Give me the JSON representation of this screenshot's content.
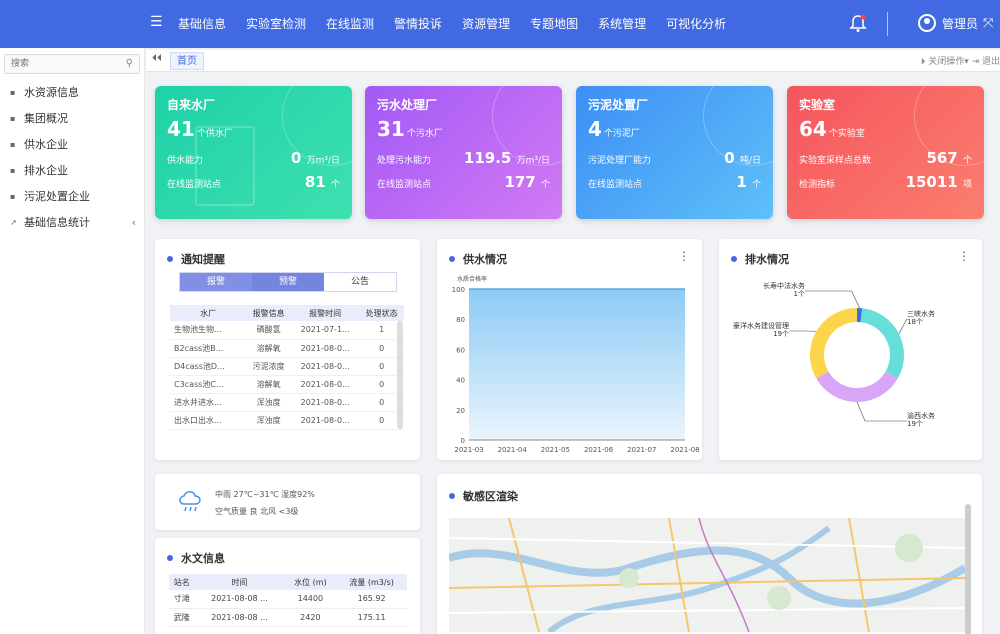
{
  "nav": {
    "items": [
      "基础信息",
      "实验室检测",
      "在线监测",
      "警情投诉",
      "资源管理",
      "专题地图",
      "系统管理",
      "可视化分析"
    ],
    "user": "管理员"
  },
  "sidebar": {
    "search_placeholder": "搜索",
    "items": [
      "水资源信息",
      "集团概况",
      "供水企业",
      "排水企业",
      "污泥处置企业",
      "基础信息统计"
    ]
  },
  "tabbar": {
    "tab": "首页",
    "right": "⏵ 关闭操作▾  ⇥ 退出"
  },
  "cards": [
    {
      "title": "自来水厂",
      "count": "41",
      "count_unit": "个供水厂",
      "r1_label": "供水能力",
      "r1_value": "0",
      "r1_unit": "万m³/日",
      "r2_label": "在线监测站点",
      "r2_value": "81",
      "r2_unit": "个",
      "color1": "#1fd1a8",
      "color2": "#2ad5a0"
    },
    {
      "title": "污水处理厂",
      "count": "31",
      "count_unit": "个污水厂",
      "r1_label": "处理污水能力",
      "r1_value": "119.5",
      "r1_unit": "万m³/日",
      "r2_label": "在线监测站点",
      "r2_value": "177",
      "r2_unit": "个",
      "color1": "#a259f5",
      "color2": "#c471f5"
    },
    {
      "title": "污泥处置厂",
      "count": "4",
      "count_unit": "个污泥厂",
      "r1_label": "污泥处理厂能力",
      "r1_value": "0",
      "r1_unit": "吨/日",
      "r2_label": "在线监测站点",
      "r2_value": "1",
      "r2_unit": "个",
      "color1": "#3d8ef5",
      "color2": "#4fb3f7"
    },
    {
      "title": "实验室",
      "count": "64",
      "count_unit": "个实验室",
      "r1_label": "实验室采样点总数",
      "r1_value": "567",
      "r1_unit": "个",
      "r2_label": "检测指标",
      "r2_value": "15011",
      "r2_unit": "项",
      "color1": "#f5555d",
      "color2": "#fb7a6e"
    }
  ],
  "notice": {
    "title": "通知提醒",
    "tabs": [
      "报警",
      "预警",
      "公告"
    ],
    "headers": [
      "水厂",
      "报警信息",
      "报警时间",
      "处理状态"
    ],
    "rows": [
      [
        "生物池生物...",
        "磷酸氢",
        "2021-07-1...",
        "1"
      ],
      [
        "B2cass池B...",
        "溶解氧",
        "2021-08-0...",
        "0"
      ],
      [
        "D4cass池D...",
        "污泥浓度",
        "2021-08-0...",
        "0"
      ],
      [
        "C3cass池C...",
        "溶解氧",
        "2021-08-0...",
        "0"
      ],
      [
        "进水井进水...",
        "浑浊度",
        "2021-08-0...",
        "0"
      ],
      [
        "出水口出水...",
        "浑浊度",
        "2021-08-0...",
        "0"
      ]
    ]
  },
  "supply": {
    "title": "供水情况",
    "unit_label": "水质合格率"
  },
  "drainage": {
    "title": "排水情况"
  },
  "weather": {
    "line1": "中雨 27℃~31℃  湿度92%",
    "line2": "空气质量 良  北风 <3级"
  },
  "hydro": {
    "title": "水文信息",
    "headers": [
      "站名",
      "时间",
      "水位 (m)",
      "流量 (m3/s)"
    ],
    "rows": [
      [
        "寸滩",
        "2021-08-08 ...",
        "14400",
        "165.92"
      ],
      [
        "武隆",
        "2021-08-08 ...",
        "2420",
        "175.11"
      ]
    ]
  },
  "sensitive": {
    "title": "敏感区渲染"
  },
  "chart_data": [
    {
      "type": "area",
      "title": "",
      "ylabel": "水质合格率",
      "x": [
        "2021-03",
        "2021-04",
        "2021-05",
        "2021-06",
        "2021-07",
        "2021-08"
      ],
      "series": [
        {
          "values": [
            100,
            100,
            100,
            100,
            100,
            100
          ]
        }
      ],
      "ylim": [
        0,
        100
      ],
      "yticks": [
        0,
        20,
        40,
        60,
        80,
        100
      ]
    },
    {
      "type": "pie",
      "categories": [
        "长寿中法水务",
        "三峡水务",
        "渝西水务",
        "豪洋水务建设管理"
      ],
      "values": [
        1,
        18,
        19,
        19
      ],
      "labels": [
        "长寿中法水务\n1个",
        "三峡水务\n18个",
        "渝西水务\n19个",
        "豪洋水务建设管理\n19个"
      ],
      "colors": [
        "#4169e1",
        "#66dfd8",
        "#d8a6f7",
        "#fdd54a"
      ]
    }
  ]
}
